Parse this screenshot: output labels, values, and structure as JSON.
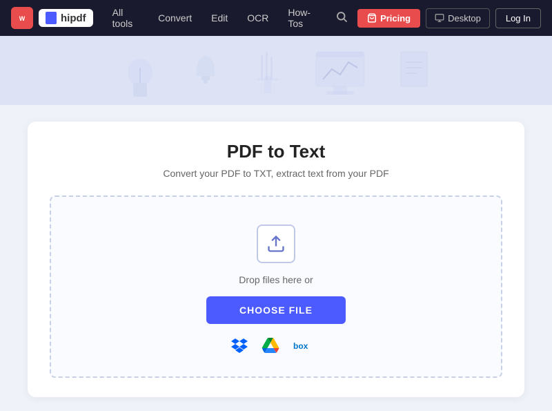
{
  "brand": {
    "wondershare_label": "ws",
    "hipdf_label": "hipdf"
  },
  "navbar": {
    "all_tools_label": "All tools",
    "convert_label": "Convert",
    "edit_label": "Edit",
    "ocr_label": "OCR",
    "howtos_label": "How-Tos",
    "pricing_label": "Pricing",
    "desktop_label": "Desktop",
    "login_label": "Log In"
  },
  "tool": {
    "title": "PDF to Text",
    "subtitle": "Convert your PDF to TXT, extract text from your PDF",
    "drop_text": "Drop files here or",
    "choose_file_label": "CHOOSE FILE"
  },
  "cloud_services": {
    "dropbox": "Dropbox",
    "google_drive": "Google Drive",
    "box": "box"
  }
}
